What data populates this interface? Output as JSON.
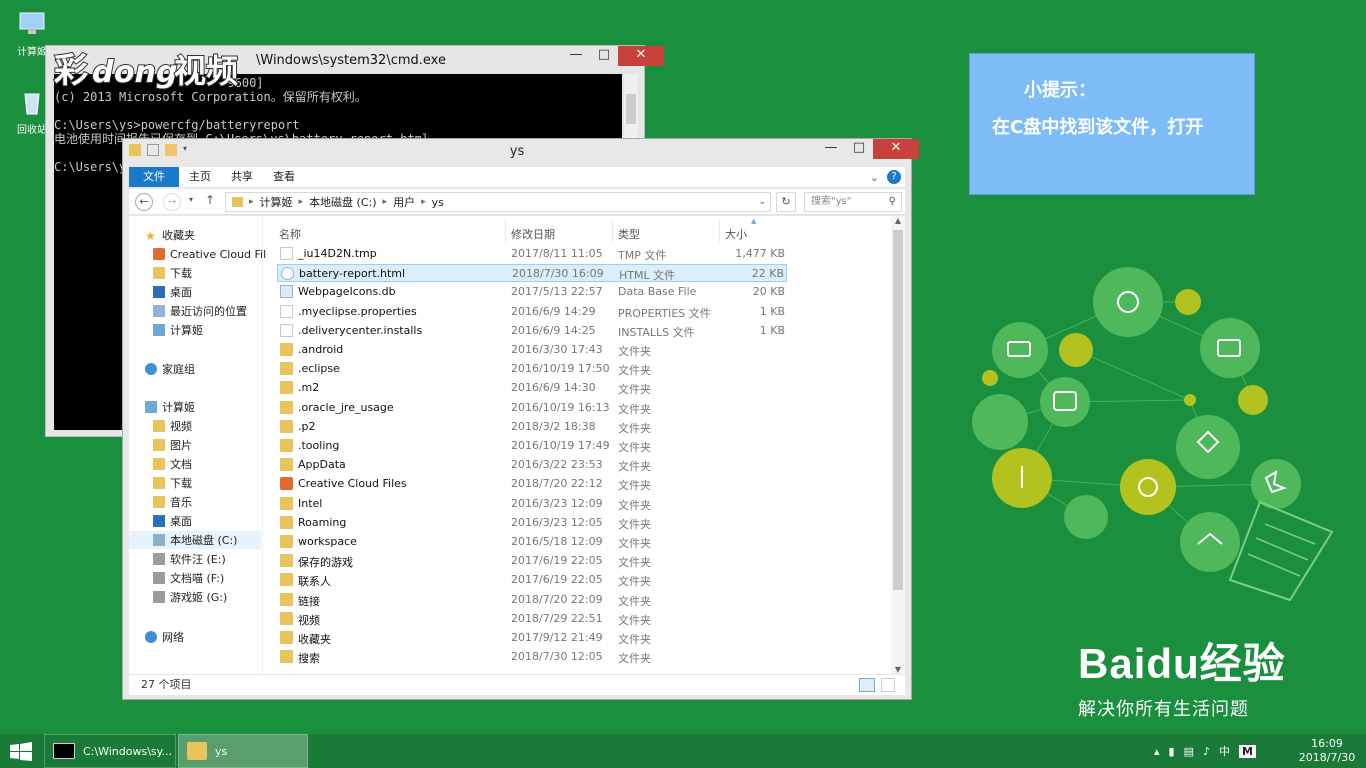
{
  "desktop": {
    "icons": [
      {
        "label": "计算姬"
      },
      {
        "label": "回收站"
      }
    ]
  },
  "watermark": {
    "text": "彩视频"
  },
  "cmd": {
    "title": "\\Windows\\system32\\cmd.exe",
    "lines": [
      "                        9600]",
      "(c) 2013 Microsoft Corporation。保留所有权利。",
      "",
      "C:\\Users\\ys>powercfg/batteryreport",
      "电池使用时间报告已保存到 C:\\Users\\ys\\battery-report.html。",
      "",
      "C:\\Users\\ys>"
    ]
  },
  "explorer": {
    "title": "ys",
    "ribbon_tabs": [
      "文件",
      "主页",
      "共享",
      "查看"
    ],
    "help": "?",
    "address": [
      "计算姬",
      "本地磁盘 (C:)",
      "用户",
      "ys"
    ],
    "search_placeholder": "搜索\"ys\"",
    "nav": {
      "favorites": "收藏夹",
      "fav_items": [
        "Creative Cloud Fil",
        "下载",
        "桌面",
        "最近访问的位置",
        "计算姬"
      ],
      "homegroup": "家庭组",
      "computer": "计算姬",
      "pc_items": [
        "视频",
        "图片",
        "文档",
        "下载",
        "音乐",
        "桌面",
        "本地磁盘 (C:)",
        "软件汪 (E:)",
        "文档喵 (F:)",
        "游戏姬 (G:)"
      ],
      "network": "网络"
    },
    "columns": [
      "名称",
      "修改日期",
      "类型",
      "大小"
    ],
    "files": [
      {
        "name": "_iu14D2N.tmp",
        "date": "2017/8/11 11:05",
        "type": "TMP 文件",
        "size": "1,477 KB",
        "icon": "file"
      },
      {
        "name": "battery-report.html",
        "date": "2018/7/30 16:09",
        "type": "HTML 文件",
        "size": "22 KB",
        "icon": "html"
      },
      {
        "name": "WebpageIcons.db",
        "date": "2017/5/13 22:57",
        "type": "Data Base File",
        "size": "20 KB",
        "icon": "db"
      },
      {
        "name": ".myeclipse.properties",
        "date": "2016/6/9 14:29",
        "type": "PROPERTIES 文件",
        "size": "1 KB",
        "icon": "file"
      },
      {
        "name": ".deliverycenter.installs",
        "date": "2016/6/9 14:25",
        "type": "INSTALLS 文件",
        "size": "1 KB",
        "icon": "file"
      },
      {
        "name": ".android",
        "date": "2016/3/30 17:43",
        "type": "文件夹",
        "size": "",
        "icon": "folder"
      },
      {
        "name": ".eclipse",
        "date": "2016/10/19 17:50",
        "type": "文件夹",
        "size": "",
        "icon": "folder"
      },
      {
        "name": ".m2",
        "date": "2016/6/9 14:30",
        "type": "文件夹",
        "size": "",
        "icon": "folder"
      },
      {
        "name": ".oracle_jre_usage",
        "date": "2016/10/19 16:13",
        "type": "文件夹",
        "size": "",
        "icon": "folder"
      },
      {
        "name": ".p2",
        "date": "2018/3/2 18:38",
        "type": "文件夹",
        "size": "",
        "icon": "folder"
      },
      {
        "name": ".tooling",
        "date": "2016/10/19 17:49",
        "type": "文件夹",
        "size": "",
        "icon": "folder"
      },
      {
        "name": "AppData",
        "date": "2016/3/22 23:53",
        "type": "文件夹",
        "size": "",
        "icon": "folder"
      },
      {
        "name": "Creative Cloud Files",
        "date": "2018/7/20 22:12",
        "type": "文件夹",
        "size": "",
        "icon": "cc"
      },
      {
        "name": "Intel",
        "date": "2016/3/23 12:09",
        "type": "文件夹",
        "size": "",
        "icon": "folder"
      },
      {
        "name": "Roaming",
        "date": "2016/3/23 12:05",
        "type": "文件夹",
        "size": "",
        "icon": "folder"
      },
      {
        "name": "workspace",
        "date": "2016/5/18 12:09",
        "type": "文件夹",
        "size": "",
        "icon": "folder"
      },
      {
        "name": "保存的游戏",
        "date": "2017/6/19 22:05",
        "type": "文件夹",
        "size": "",
        "icon": "folder"
      },
      {
        "name": "联系人",
        "date": "2017/6/19 22:05",
        "type": "文件夹",
        "size": "",
        "icon": "folder"
      },
      {
        "name": "链接",
        "date": "2018/7/20 22:09",
        "type": "文件夹",
        "size": "",
        "icon": "folder"
      },
      {
        "name": "视频",
        "date": "2018/7/29 22:51",
        "type": "文件夹",
        "size": "",
        "icon": "folder"
      },
      {
        "name": "收藏夹",
        "date": "2017/9/12 21:49",
        "type": "文件夹",
        "size": "",
        "icon": "folder"
      },
      {
        "name": "搜索",
        "date": "2018/7/30 12:05",
        "type": "文件夹",
        "size": "",
        "icon": "folder"
      }
    ],
    "selected_index": 1,
    "status": "27 个项目"
  },
  "tip": {
    "title": "小提示：",
    "body": "在C盘中找到该文件，打开"
  },
  "brand": {
    "logo": "Baidu经验",
    "slogan": "解决你所有生活问题"
  },
  "taskbar": {
    "buttons": [
      "C:\\Windows\\sy...",
      "ys"
    ],
    "tray_lang": "中",
    "tray_ime": "M",
    "time": "16:09",
    "date": "2018/7/30"
  },
  "colors": {
    "desktop": "#1a8f3d",
    "accent": "#1979ca",
    "tip": "#7dbcf7",
    "close": "#c7423b"
  }
}
